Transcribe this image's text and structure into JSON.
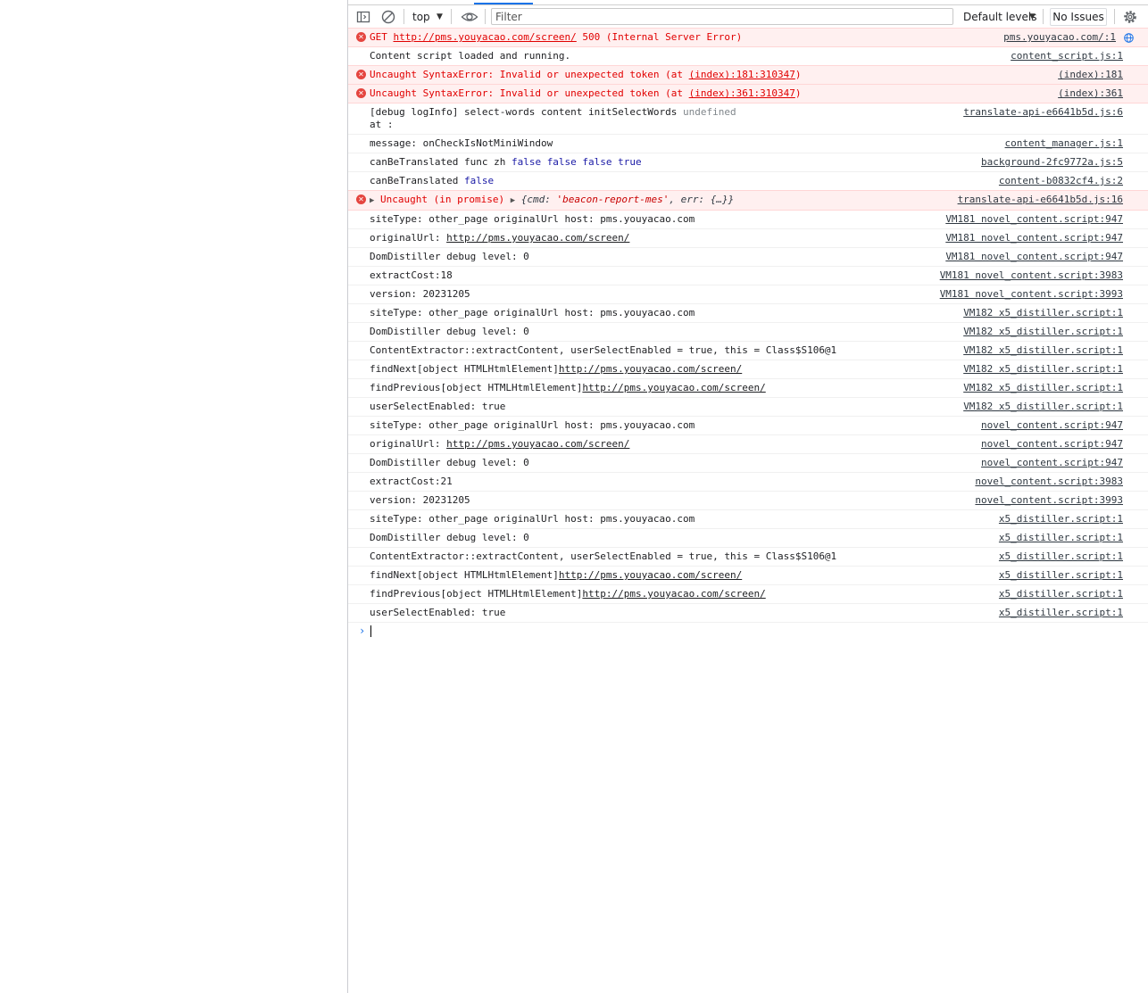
{
  "toolbar": {
    "context": "top",
    "filter_placeholder": "Filter",
    "levels": "Default levels",
    "issues": "No Issues"
  },
  "console": {
    "m0": {
      "pre": "GET ",
      "url": "http://pms.youyacao.com/screen/",
      "post": " 500 (Internal Server Error)",
      "src": "pms.youyacao.com/:1"
    },
    "m1": {
      "text": "Content script loaded and running.",
      "src": "content_script.js:1"
    },
    "m2": {
      "pre": "Uncaught SyntaxError: Invalid or unexpected token (at ",
      "link": "(index):181:310347",
      "post": ")",
      "src": "(index):181"
    },
    "m3": {
      "pre": "Uncaught SyntaxError: Invalid or unexpected token (at ",
      "link": "(index):361:310347",
      "post": ")",
      "src": "(index):361"
    },
    "m4": {
      "text": "[debug logInfo] select-words content initSelectWords ",
      "und": "undefined",
      "line2": "at  :",
      "src": "translate-api-e6641b5d.js:6"
    },
    "m5": {
      "text": "message: onCheckIsNotMiniWindow",
      "src": "content_manager.js:1"
    },
    "m6": {
      "text": "canBeTranslated func zh ",
      "vals": "false false false true",
      "src": "background-2fc9772a.js:5"
    },
    "m7": {
      "text": "canBeTranslated ",
      "val": "false",
      "src": "content-b0832cf4.js:2"
    },
    "m8": {
      "pre": "Uncaught (in promise) ",
      "obj_open": "{cmd: ",
      "cmd": "'beacon-report-mes'",
      "obj_rest": ", err: {…}}",
      "src": "translate-api-e6641b5d.js:16"
    },
    "m9": {
      "text": "siteType: other_page originalUrl host: pms.youyacao.com",
      "src": "VM181 novel_content.script:947"
    },
    "m10": {
      "text": "originalUrl: ",
      "url": "http://pms.youyacao.com/screen/",
      "src": "VM181 novel_content.script:947"
    },
    "m11": {
      "text": "DomDistiller debug level: 0",
      "src": "VM181 novel_content.script:947"
    },
    "m12": {
      "text": "extractCost:18",
      "src": "VM181 novel_content.script:3983"
    },
    "m13": {
      "text": "version: 20231205",
      "src": "VM181 novel_content.script:3993"
    },
    "m14": {
      "text": "siteType: other_page originalUrl host: pms.youyacao.com",
      "src": "VM182 x5_distiller.script:1"
    },
    "m15": {
      "text": "DomDistiller debug level: 0",
      "src": "VM182 x5_distiller.script:1"
    },
    "m16": {
      "text": "ContentExtractor::extractContent, userSelectEnabled = true, this = Class$S106@1",
      "src": "VM182 x5_distiller.script:1"
    },
    "m17": {
      "text": "findNext[object HTMLHtmlElement]",
      "url": "http://pms.youyacao.com/screen/",
      "src": "VM182 x5_distiller.script:1"
    },
    "m18": {
      "text": "findPrevious[object HTMLHtmlElement]",
      "url": "http://pms.youyacao.com/screen/",
      "src": "VM182 x5_distiller.script:1"
    },
    "m19": {
      "text": "userSelectEnabled: true",
      "src": "VM182 x5_distiller.script:1"
    },
    "m20": {
      "text": "siteType: other_page originalUrl host: pms.youyacao.com",
      "src": "novel_content.script:947"
    },
    "m21": {
      "text": "originalUrl: ",
      "url": "http://pms.youyacao.com/screen/",
      "src": "novel_content.script:947"
    },
    "m22": {
      "text": "DomDistiller debug level: 0",
      "src": "novel_content.script:947"
    },
    "m23": {
      "text": "extractCost:21",
      "src": "novel_content.script:3983"
    },
    "m24": {
      "text": "version: 20231205",
      "src": "novel_content.script:3993"
    },
    "m25": {
      "text": "siteType: other_page originalUrl host: pms.youyacao.com",
      "src": "x5_distiller.script:1"
    },
    "m26": {
      "text": "DomDistiller debug level: 0",
      "src": "x5_distiller.script:1"
    },
    "m27": {
      "text": "ContentExtractor::extractContent, userSelectEnabled = true, this = Class$S106@1",
      "src": "x5_distiller.script:1"
    },
    "m28": {
      "text": "findNext[object HTMLHtmlElement]",
      "url": "http://pms.youyacao.com/screen/",
      "src": "x5_distiller.script:1"
    },
    "m29": {
      "text": "findPrevious[object HTMLHtmlElement]",
      "url": "http://pms.youyacao.com/screen/",
      "src": "x5_distiller.script:1"
    },
    "m30": {
      "text": "userSelectEnabled: true",
      "src": "x5_distiller.script:1"
    }
  },
  "colors": {
    "error_text": "#e10000",
    "error_bg": "#fff0f0",
    "accent": "#1a73e8"
  }
}
